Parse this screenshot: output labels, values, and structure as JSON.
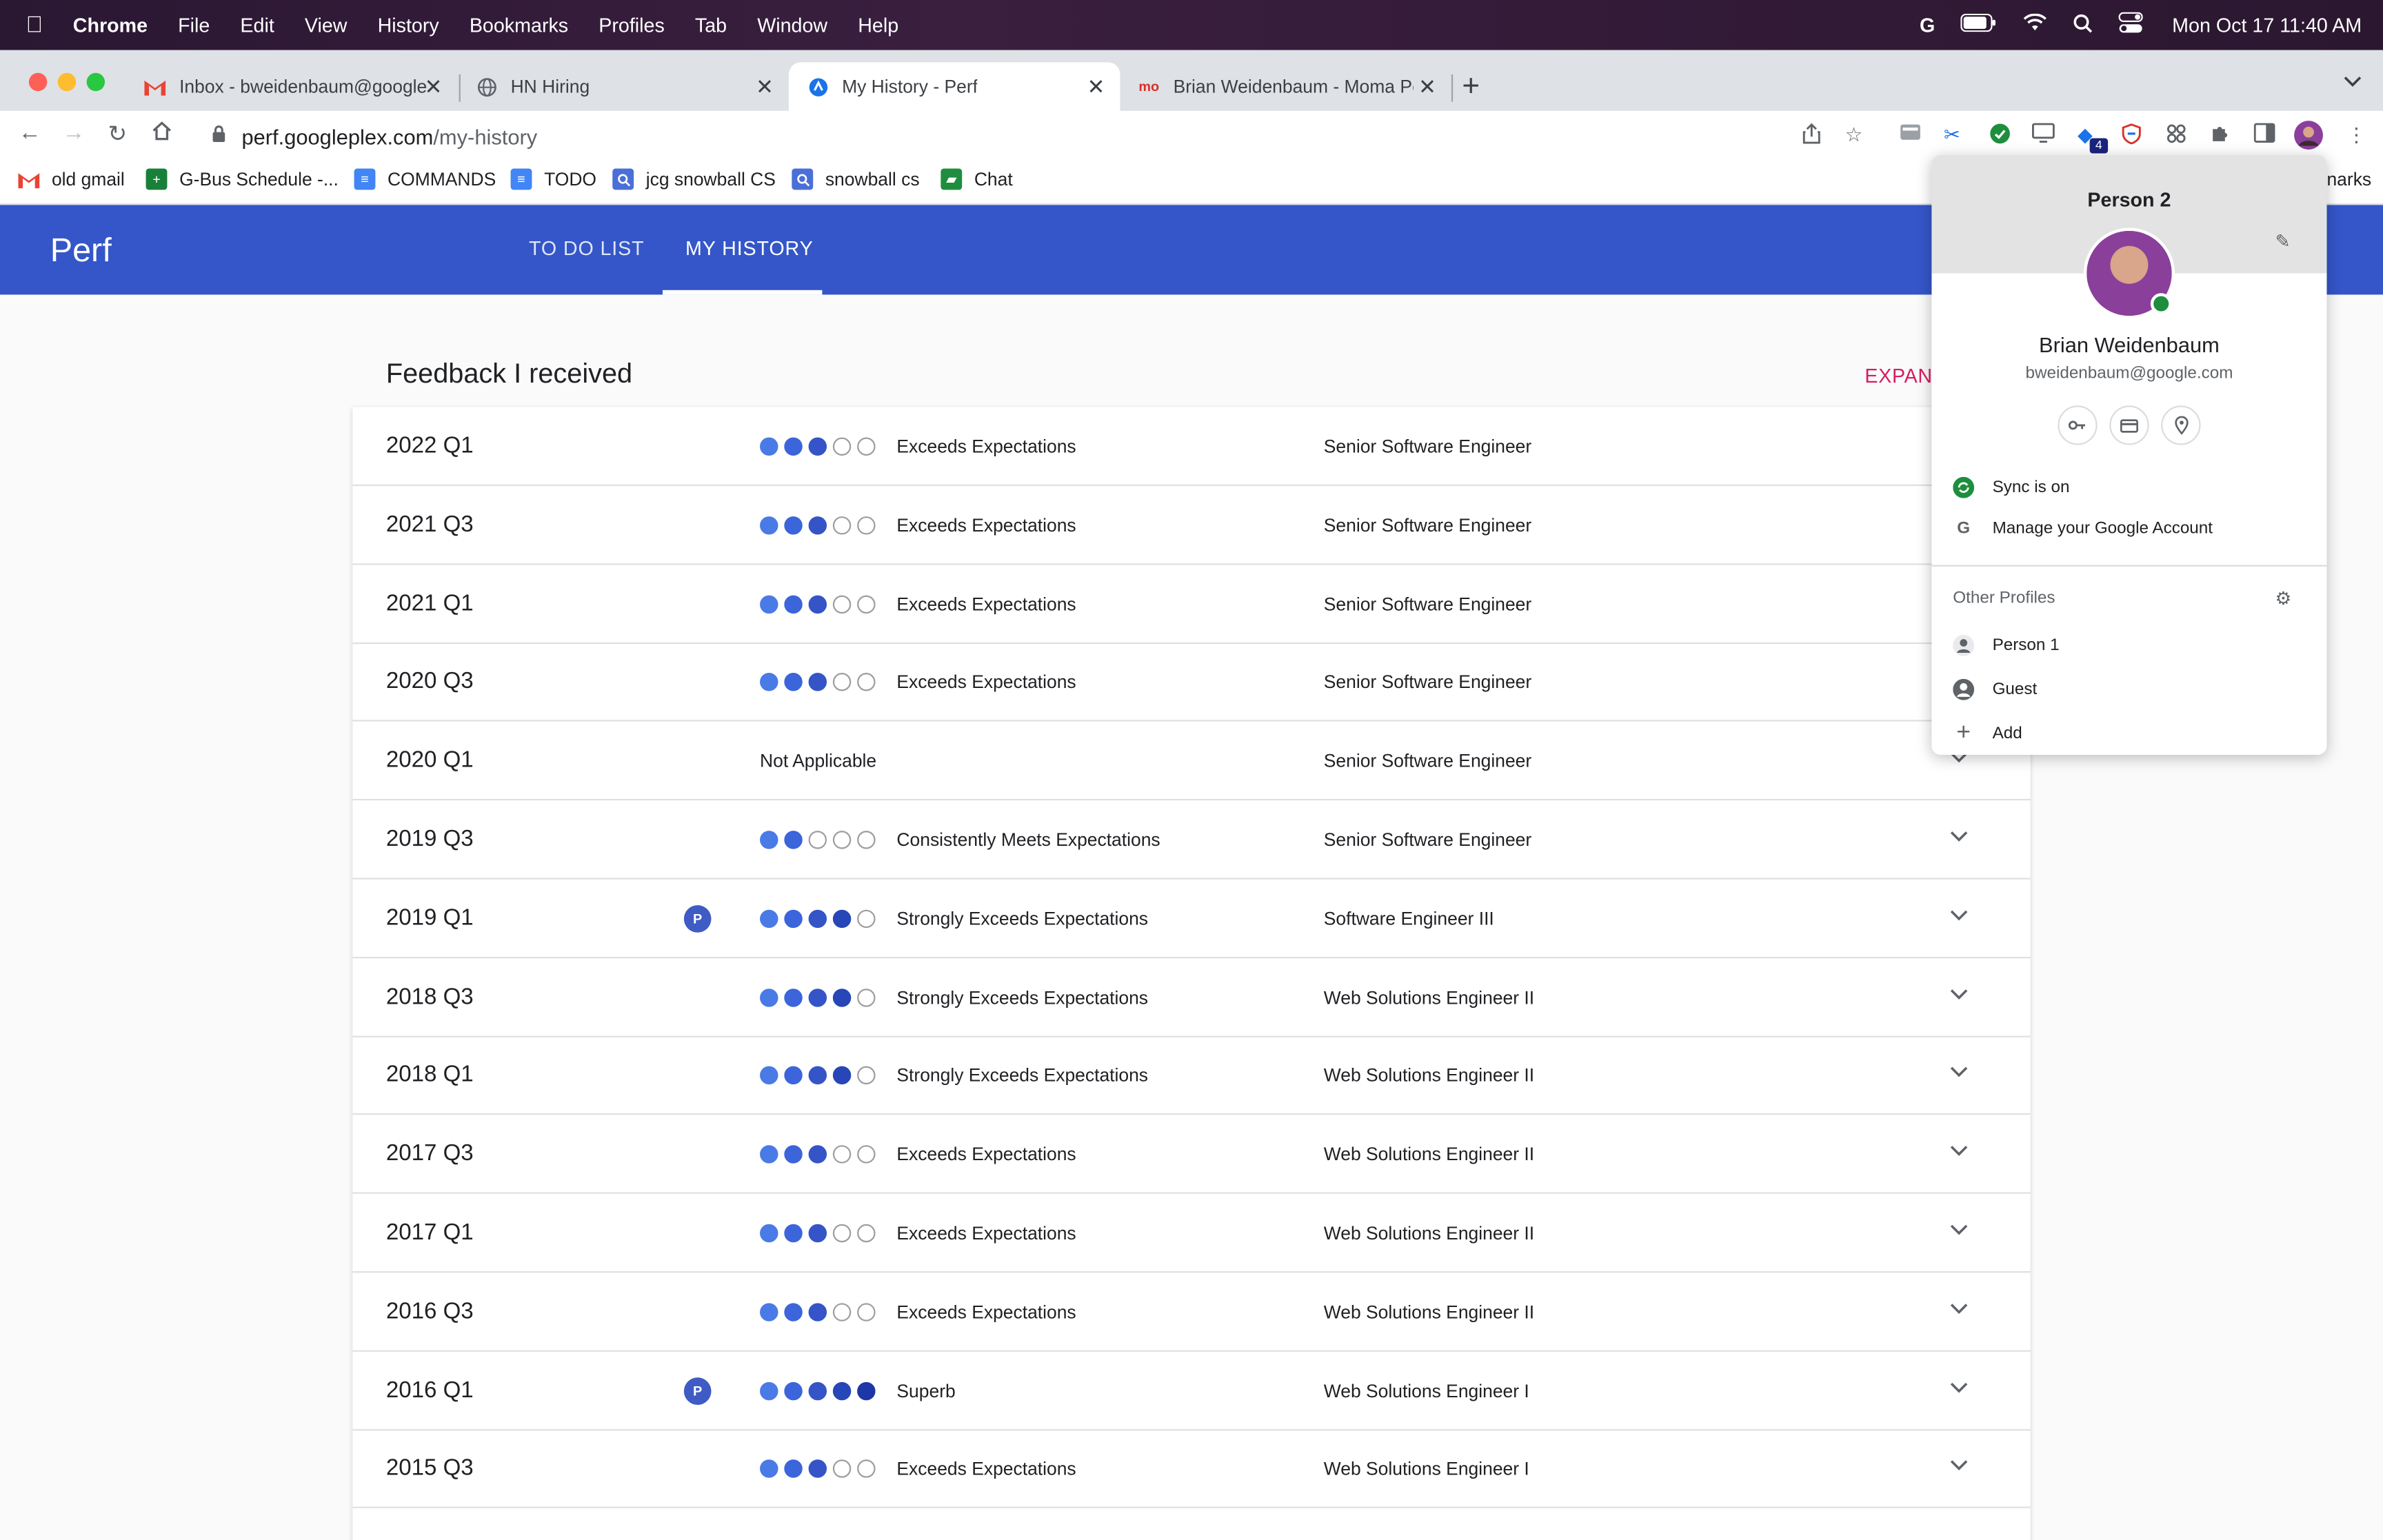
{
  "menubar": {
    "app": "Chrome",
    "items": [
      "File",
      "Edit",
      "View",
      "History",
      "Bookmarks",
      "Profiles",
      "Tab",
      "Window",
      "Help"
    ],
    "clock": "Mon Oct 17  11:40 AM"
  },
  "tabs": [
    {
      "title": "Inbox - bweidenbaum@google",
      "icon": "gmail-icon"
    },
    {
      "title": "HN Hiring",
      "icon": "globe-icon"
    },
    {
      "title": "My History - Perf",
      "icon": "perf-icon",
      "active": true
    },
    {
      "title": "Brian Weidenbaum - Moma Pe",
      "icon": "moma-icon"
    }
  ],
  "toolbar": {
    "url_host": "perf.googleplex.com",
    "url_path": "/my-history",
    "ext_badge": "4"
  },
  "bookmarks": [
    {
      "label": "old gmail",
      "icon": "gmail-icon"
    },
    {
      "label": "G-Bus Schedule -...",
      "icon": "sheets-icon"
    },
    {
      "label": "COMMANDS",
      "icon": "docs-icon"
    },
    {
      "label": "TODO",
      "icon": "docs-icon"
    },
    {
      "label": "jcg snowball CS",
      "icon": "search-icon"
    },
    {
      "label": "snowball cs",
      "icon": "search-icon"
    },
    {
      "label": "Chat",
      "icon": "chat-icon"
    }
  ],
  "bookmarks_overflow": "narks",
  "app": {
    "brand": "Perf",
    "nav": [
      "TO DO LIST",
      "MY HISTORY"
    ]
  },
  "feedback": {
    "title": "Feedback I received",
    "expand_label": "EXPAND",
    "rows": [
      {
        "period": "2022 Q1",
        "rating": "Exceeds Expectations",
        "level": 3,
        "title": "Senior Software Engineer",
        "promo": false
      },
      {
        "period": "2021 Q3",
        "rating": "Exceeds Expectations",
        "level": 3,
        "title": "Senior Software Engineer",
        "promo": false
      },
      {
        "period": "2021 Q1",
        "rating": "Exceeds Expectations",
        "level": 3,
        "title": "Senior Software Engineer",
        "promo": false
      },
      {
        "period": "2020 Q3",
        "rating": "Exceeds Expectations",
        "level": 3,
        "title": "Senior Software Engineer",
        "promo": false
      },
      {
        "period": "2020 Q1",
        "rating": "Not Applicable",
        "level": 0,
        "title": "Senior Software Engineer",
        "promo": false
      },
      {
        "period": "2019 Q3",
        "rating": "Consistently Meets Expectations",
        "level": 2,
        "title": "Senior Software Engineer",
        "promo": false
      },
      {
        "period": "2019 Q1",
        "rating": "Strongly Exceeds Expectations",
        "level": 4,
        "title": "Software Engineer III",
        "promo": true
      },
      {
        "period": "2018 Q3",
        "rating": "Strongly Exceeds Expectations",
        "level": 4,
        "title": "Web Solutions Engineer II",
        "promo": false
      },
      {
        "period": "2018 Q1",
        "rating": "Strongly Exceeds Expectations",
        "level": 4,
        "title": "Web Solutions Engineer II",
        "promo": false
      },
      {
        "period": "2017 Q3",
        "rating": "Exceeds Expectations",
        "level": 3,
        "title": "Web Solutions Engineer II",
        "promo": false
      },
      {
        "period": "2017 Q1",
        "rating": "Exceeds Expectations",
        "level": 3,
        "title": "Web Solutions Engineer II",
        "promo": false
      },
      {
        "period": "2016 Q3",
        "rating": "Exceeds Expectations",
        "level": 3,
        "title": "Web Solutions Engineer II",
        "promo": false
      },
      {
        "period": "2016 Q1",
        "rating": "Superb",
        "level": 5,
        "title": "Web Solutions Engineer I",
        "promo": true
      },
      {
        "period": "2015 Q3",
        "rating": "Exceeds Expectations",
        "level": 3,
        "title": "Web Solutions Engineer I",
        "promo": false
      }
    ],
    "promo_badge": "P"
  },
  "profile_menu": {
    "profile_name": "Person 2",
    "user_name": "Brian Weidenbaum",
    "user_email": "bweidenbaum@google.com",
    "sync": "Sync is on",
    "manage": "Manage your Google Account",
    "other_profiles_label": "Other Profiles",
    "others": [
      {
        "label": "Person 1",
        "icon": "person-icon"
      },
      {
        "label": "Guest",
        "icon": "guest-icon"
      },
      {
        "label": "Add",
        "icon": "plus-icon"
      }
    ]
  },
  "colors": {
    "appbar": "#3456c8",
    "accent_link": "#d81b60",
    "dot_fill": "#3c65db"
  }
}
